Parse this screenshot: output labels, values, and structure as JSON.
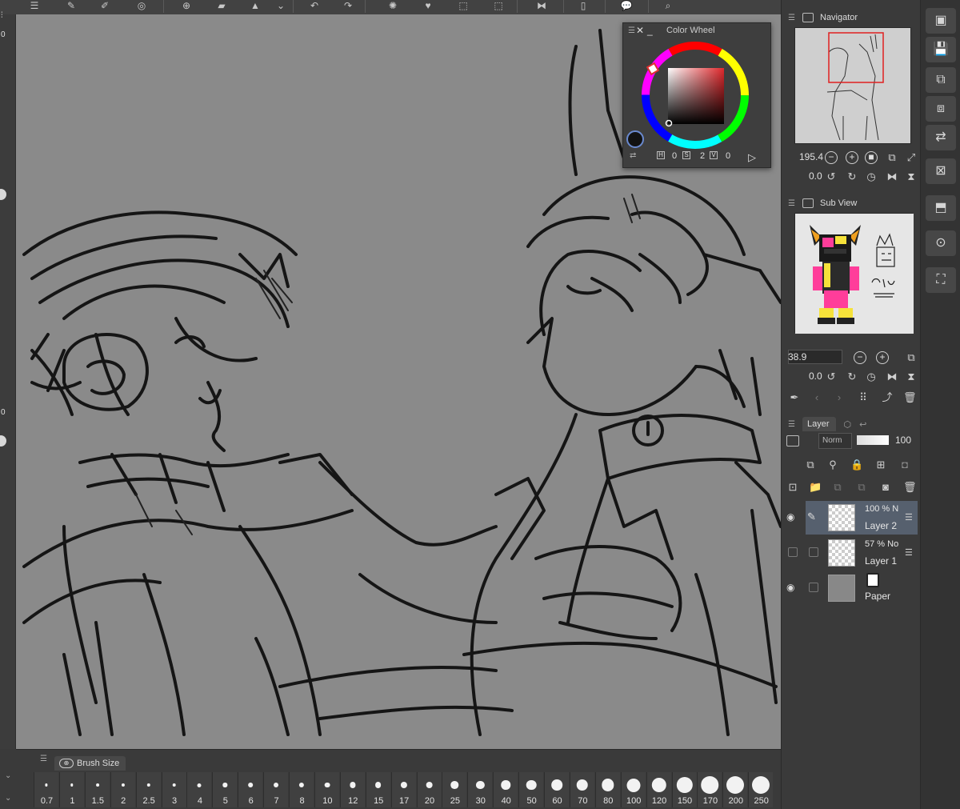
{
  "app": {
    "left_strip": {
      "top_value": "0",
      "mid_value": "0"
    }
  },
  "color_wheel": {
    "title": "Color Wheel",
    "h_label": "H",
    "h_value": "0",
    "s_label": "S",
    "s_value": "2",
    "v_label": "V",
    "v_value": "0",
    "selected_color": "#121212",
    "hue_color": "#e0282c"
  },
  "navigator": {
    "title": "Navigator",
    "zoom": "195.4",
    "rotation": "0.0"
  },
  "sub_view": {
    "title": "Sub View",
    "zoom": "38.9",
    "rotation": "0.0"
  },
  "layer_panel": {
    "title": "Layer",
    "blend_mode": "Norm",
    "opacity": "100",
    "layers": [
      {
        "opacity": "100 % N",
        "name": "Layer 2",
        "visible": true,
        "selected": true
      },
      {
        "opacity": "57 % No",
        "name": "Layer 1",
        "visible": false,
        "selected": false
      },
      {
        "opacity": "",
        "name": "Paper",
        "visible": true,
        "selected": false
      }
    ]
  },
  "brush_size": {
    "title": "Brush Size",
    "sizes": [
      "0.7",
      "1",
      "1.5",
      "2",
      "2.5",
      "3",
      "4",
      "5",
      "6",
      "7",
      "8",
      "10",
      "12",
      "15",
      "17",
      "20",
      "25",
      "30",
      "40",
      "50",
      "60",
      "70",
      "80",
      "100",
      "120",
      "150",
      "170",
      "200",
      "250"
    ]
  },
  "colors": {
    "canvas_bg": "#8a8a8a",
    "panel_bg": "#3a3a3a",
    "selection": "#56606e",
    "nav_frame": "#e02020"
  }
}
